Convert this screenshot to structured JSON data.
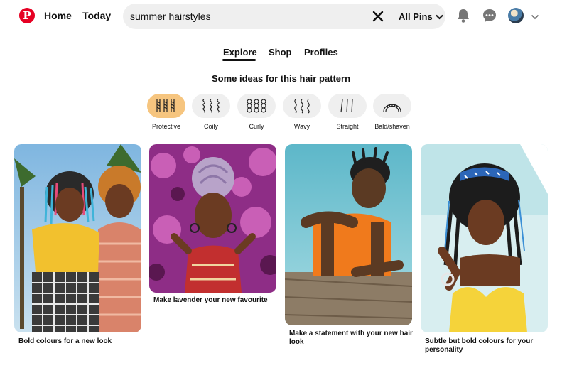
{
  "header": {
    "logo_letter": "P",
    "nav": [
      "Home",
      "Today"
    ],
    "search_value": "summer hairstyles",
    "filter_label": "All Pins",
    "icons": [
      "notifications-icon",
      "messages-icon",
      "avatar",
      "chevron-down-icon"
    ]
  },
  "tabs": [
    "Explore",
    "Shop",
    "Profiles"
  ],
  "active_tab": "Explore",
  "ideas_heading": "Some ideas for this hair pattern",
  "hair_patterns": [
    {
      "label": "Protective",
      "active": true
    },
    {
      "label": "Coily",
      "active": false
    },
    {
      "label": "Curly",
      "active": false
    },
    {
      "label": "Wavy",
      "active": false
    },
    {
      "label": "Straight",
      "active": false
    },
    {
      "label": "Bald/shaven",
      "active": false
    }
  ],
  "pins": [
    {
      "caption": "Bold colours for a new look"
    },
    {
      "caption": "Make lavender your new favourite"
    },
    {
      "caption": "Make a statement with your new hair look"
    },
    {
      "caption": "Subtle but bold colours for your personality"
    }
  ],
  "colors": {
    "brand": "#e60023",
    "chip_active": "#f6c57f",
    "chip": "#efefef",
    "search_bg": "#efefef"
  }
}
